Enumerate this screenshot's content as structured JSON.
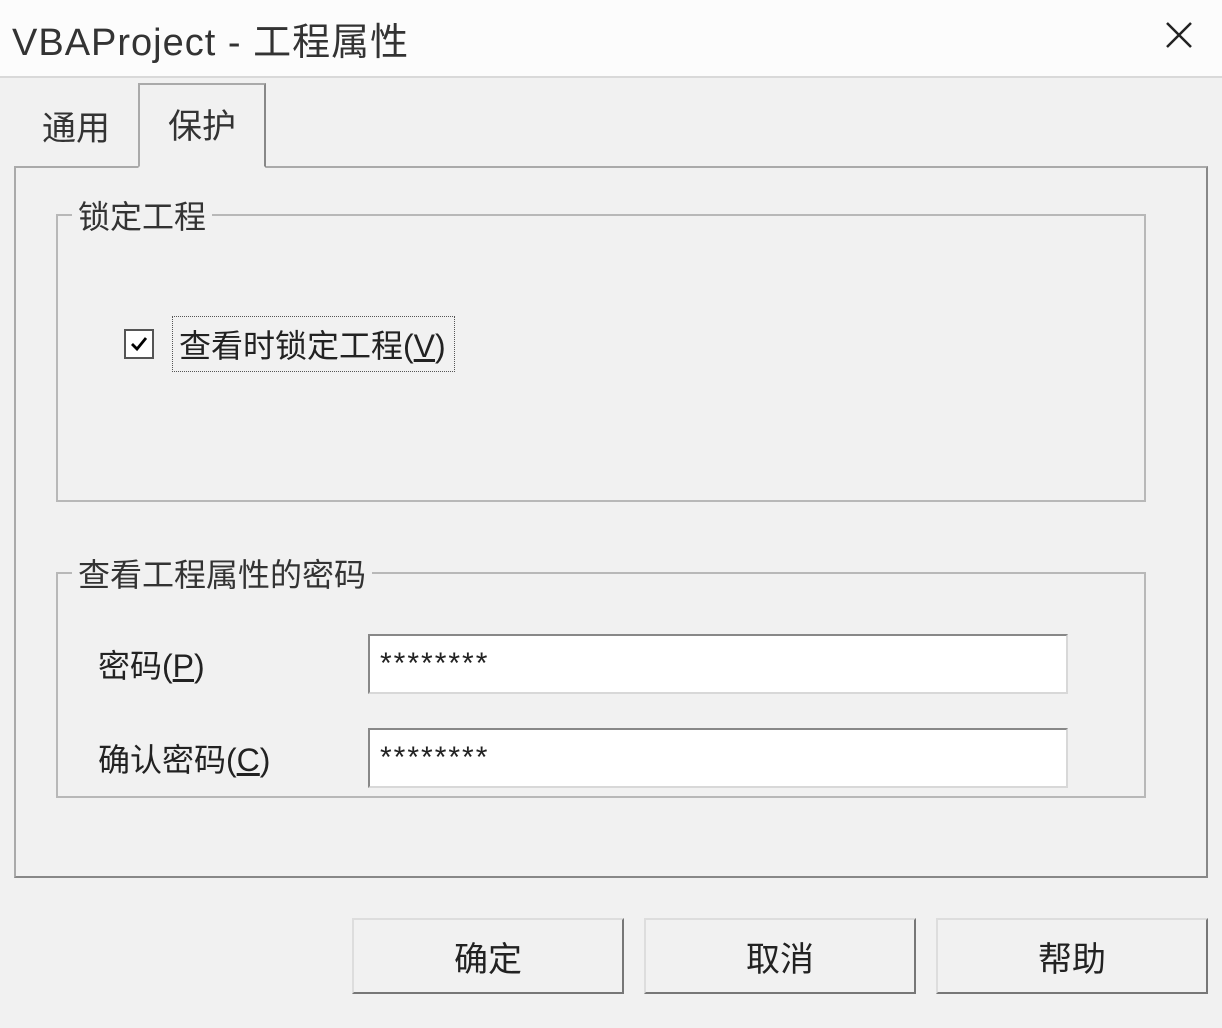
{
  "window": {
    "title": "VBAProject - 工程属性"
  },
  "tabs": {
    "general": "通用",
    "protect": "保护",
    "active": "protect"
  },
  "group_lock": {
    "legend": "锁定工程",
    "checkbox_label_pre": "查看时锁定工程(",
    "checkbox_label_key": "V",
    "checkbox_label_post": ")",
    "checked": true
  },
  "group_password": {
    "legend": "查看工程属性的密码",
    "password_label_pre": "密码(",
    "password_label_key": "P",
    "password_label_post": ")",
    "password_value": "********",
    "confirm_label_pre": "确认密码(",
    "confirm_label_key": "C",
    "confirm_label_post": ")",
    "confirm_value": "********"
  },
  "buttons": {
    "ok": "确定",
    "cancel": "取消",
    "help": "帮助"
  }
}
